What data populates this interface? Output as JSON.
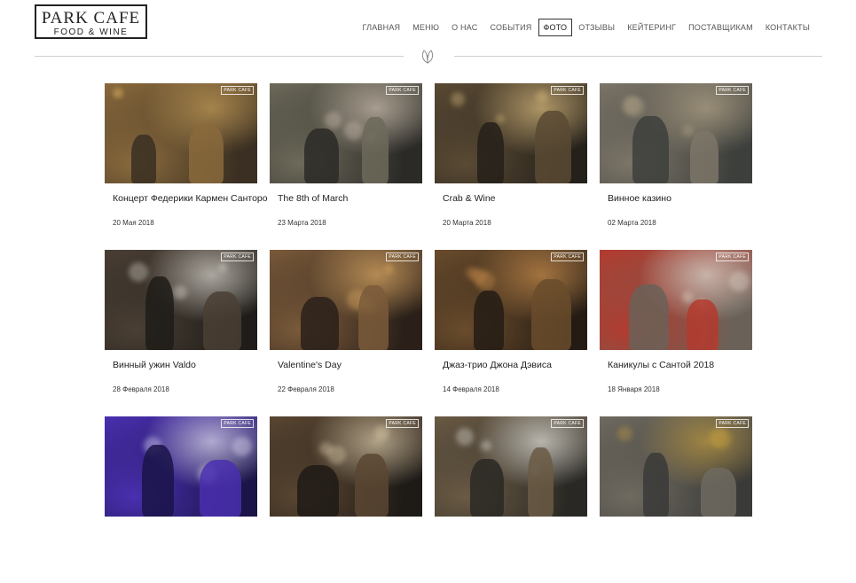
{
  "logo": {
    "line1": "PARK CAFE",
    "line2": "FOOD & WINE"
  },
  "nav": [
    {
      "label": "ГЛАВНАЯ",
      "active": false
    },
    {
      "label": "МЕНЮ",
      "active": false
    },
    {
      "label": "О НАС",
      "active": false
    },
    {
      "label": "СОБЫТИЯ",
      "active": false
    },
    {
      "label": "ФОТО",
      "active": true
    },
    {
      "label": "ОТЗЫВЫ",
      "active": false
    },
    {
      "label": "КЕЙТЕРИНГ",
      "active": false
    },
    {
      "label": "ПОСТАВЩИКАМ",
      "active": false
    },
    {
      "label": "КОНТАКТЫ",
      "active": false
    }
  ],
  "divider_icon": "leaf-icon",
  "badge_text": "PARK CAFE",
  "albums": [
    {
      "title": "Концерт Федерики Кармен Санторо",
      "date": "20 Мая 2018",
      "palette": [
        "#3a2f22",
        "#8a6a3c",
        "#c9a15a"
      ]
    },
    {
      "title": "The 8th of March",
      "date": "23 Марта 2018",
      "palette": [
        "#2b2a27",
        "#6d6a5a",
        "#d8c8b8"
      ]
    },
    {
      "title": "Crab & Wine",
      "date": "20 Марта 2018",
      "palette": [
        "#24201a",
        "#5a4a34",
        "#e7c786"
      ]
    },
    {
      "title": "Винное казино",
      "date": "02 Марта 2018",
      "palette": [
        "#3d3f3c",
        "#7c7568",
        "#b9a98c"
      ]
    },
    {
      "title": "Винный ужин Valdo",
      "date": "28 Февраля 2018",
      "palette": [
        "#1f1c19",
        "#4a3f34",
        "#e8e4dc"
      ]
    },
    {
      "title": "Valentine's Day",
      "date": "22 Февраля 2018",
      "palette": [
        "#2a2019",
        "#7a5a3a",
        "#e9b36a"
      ]
    },
    {
      "title": "Джаз-трио Джона Дэвиса",
      "date": "14 Февраля 2018",
      "palette": [
        "#241c14",
        "#6a4c2c",
        "#d49450"
      ]
    },
    {
      "title": "Каникулы с Сантой 2018",
      "date": "18 Января 2018",
      "palette": [
        "#6a6258",
        "#b43a2e",
        "#e8e2d8"
      ]
    },
    {
      "title": "",
      "date": "",
      "palette": [
        "#1a1448",
        "#4a2fb0",
        "#f2efff"
      ]
    },
    {
      "title": "",
      "date": "",
      "palette": [
        "#1e1a16",
        "#5a4632",
        "#ead9b6"
      ]
    },
    {
      "title": "",
      "date": "",
      "palette": [
        "#2a2824",
        "#6a5a44",
        "#f0f0ea"
      ]
    },
    {
      "title": "",
      "date": "",
      "palette": [
        "#3a3a38",
        "#6f6a60",
        "#c6a040"
      ]
    }
  ]
}
